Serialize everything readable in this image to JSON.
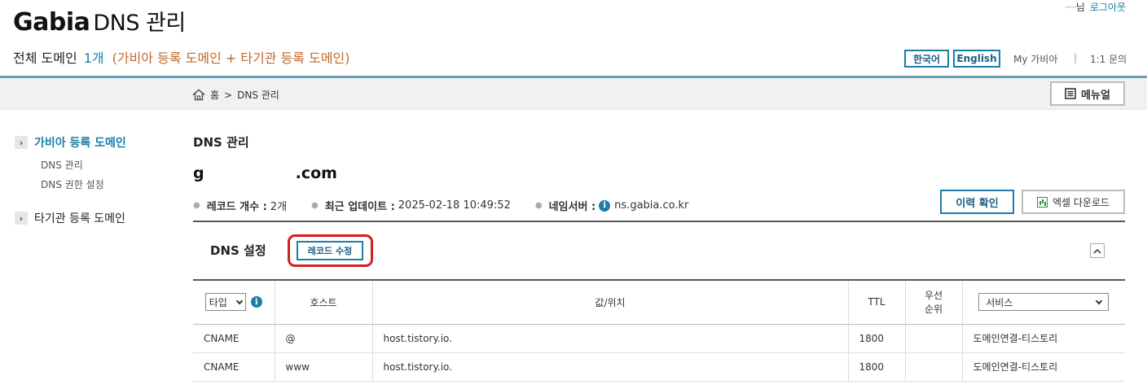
{
  "header": {
    "brand": "Gabia",
    "title": "DNS 관리",
    "summary_label": "전체 도메인",
    "summary_count": "1개",
    "summary_detail": "(가비아 등록 도메인 + 타기관 등록 도메인)",
    "user_name_masked": "·····",
    "user_suffix": "님",
    "logout": "로그아웃",
    "lang_ko": "한국어",
    "lang_en": "English",
    "my_gabia": "My 가비아",
    "separator": "|",
    "inquiry": "1:1 문의"
  },
  "breadcrumb": {
    "home": "홈",
    "sep": ">",
    "current": "DNS 관리"
  },
  "manual_button": "메뉴얼",
  "sidebar": {
    "group1": "가비아 등록 도메인",
    "group1_items": [
      "DNS 관리",
      "DNS 권한 설정"
    ],
    "group2": "타기관 등록 도메인"
  },
  "main": {
    "title": "DNS 관리",
    "domain_prefix": "g",
    "domain_suffix": ".com",
    "stats": {
      "record_count_label": "레코드 개수 :",
      "record_count": "2개",
      "updated_label": "최근 업데이트 :",
      "updated": "2025-02-18 10:49:52",
      "nameserver_label": "네임서버 :",
      "nameserver": "ns.gabia.co.kr"
    },
    "history_button": "이력 확인",
    "excel_button": "엑셀 다운로드",
    "section_title": "DNS 설정",
    "edit_button": "레코드 수정",
    "table": {
      "type_select": "타입",
      "host": "호스트",
      "value": "값/위치",
      "ttl": "TTL",
      "priority_line1": "우선",
      "priority_line2": "순위",
      "service_select": "서비스",
      "rows": [
        {
          "type": "CNAME",
          "host": "@",
          "value": "host.tistory.io.",
          "ttl": "1800",
          "priority": "",
          "service": "도메인연결-티스토리"
        },
        {
          "type": "CNAME",
          "host": "www",
          "value": "host.tistory.io.",
          "ttl": "1800",
          "priority": "",
          "service": "도메인연결-티스토리"
        }
      ]
    }
  },
  "colors": {
    "accent": "#1a7ea6",
    "highlight": "#d02020",
    "summary_detail": "#c0692a"
  }
}
